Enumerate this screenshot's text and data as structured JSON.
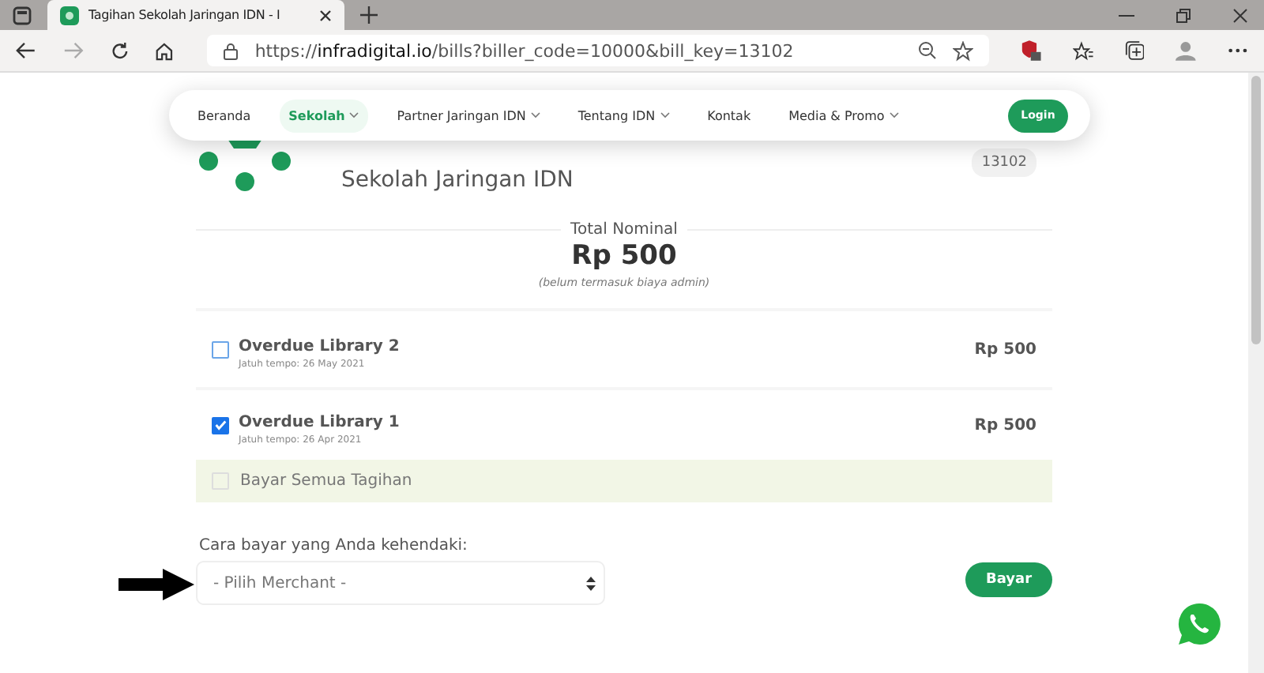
{
  "browser": {
    "tab_title": "Tagihan Sekolah Jaringan IDN - I",
    "url_prefix": "https://",
    "url_domain": "infradigital.io",
    "url_rest": "/bills?biller_code=10000&bill_key=13102"
  },
  "nav": {
    "items": [
      {
        "label": "Beranda",
        "selected": false,
        "dropdown": false
      },
      {
        "label": "Sekolah",
        "selected": true,
        "dropdown": true
      },
      {
        "label": "Partner Jaringan IDN",
        "selected": false,
        "dropdown": true
      },
      {
        "label": "Tentang IDN",
        "selected": false,
        "dropdown": true
      },
      {
        "label": "Kontak",
        "selected": false,
        "dropdown": false
      },
      {
        "label": "Media & Promo",
        "selected": false,
        "dropdown": true
      }
    ],
    "login": "Login"
  },
  "header": {
    "subtitle": "Sekolah Jaringan IDN",
    "bill_key": "13102"
  },
  "total": {
    "label": "Total Nominal",
    "amount": "Rp 500",
    "note": "(belum termasuk biaya admin)"
  },
  "bills": [
    {
      "name": "Overdue Library 2",
      "due": "Jatuh tempo: 26 May 2021",
      "amount": "Rp 500",
      "checked": false
    },
    {
      "name": "Overdue Library 1",
      "due": "Jatuh tempo: 26 Apr 2021",
      "amount": "Rp 500",
      "checked": true
    }
  ],
  "pay_all": {
    "label": "Bayar Semua Tagihan",
    "checked": false
  },
  "payment": {
    "label": "Cara bayar yang Anda kehendaki:",
    "placeholder": "- Pilih Merchant -",
    "button": "Bayar"
  }
}
